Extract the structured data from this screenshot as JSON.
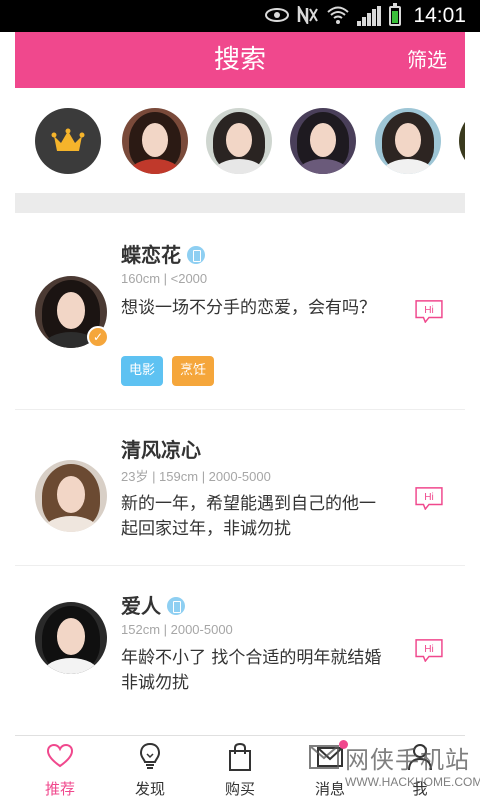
{
  "status_bar": {
    "time": "14:01",
    "icons": [
      "eye-icon",
      "nfc-icon",
      "wifi-icon",
      "signal-icon",
      "battery-charging-icon"
    ]
  },
  "header": {
    "title": "搜索",
    "filter_label": "筛选",
    "background_color": "#f0488d"
  },
  "avatar_strip": {
    "vip_icon": "crown-icon",
    "crown_color": "#f5b42b",
    "avatars": [
      "avatar-1",
      "avatar-2",
      "avatar-3",
      "avatar-4",
      "avatar-5"
    ]
  },
  "feed": [
    {
      "name": "蝶恋花",
      "phone_verified": true,
      "meta": "160cm | <2000",
      "text": "想谈一场不分手的恋爱，会有吗？",
      "avatar_verified": true,
      "tags": [
        {
          "label": "电影",
          "color": "#5ec2f2"
        },
        {
          "label": "烹饪",
          "color": "#f5a63b"
        }
      ]
    },
    {
      "name": "清风凉心",
      "phone_verified": false,
      "meta": "23岁 | 159cm | 2000-5000",
      "text": "新的一年，希望能遇到自己的他一起回家过年，非诚勿扰",
      "avatar_verified": false,
      "tags": []
    },
    {
      "name": "爱人",
      "phone_verified": true,
      "meta": "152cm | 2000-5000",
      "text": "年龄不小了 找个合适的明年就结婚　非诚勿扰",
      "avatar_verified": false,
      "tags": []
    }
  ],
  "hi_label": "Hi",
  "tabs": [
    {
      "label": "推荐",
      "icon": "heart-icon",
      "active": true
    },
    {
      "label": "发现",
      "icon": "lightbulb-icon",
      "active": false
    },
    {
      "label": "购买",
      "icon": "shopping-bag-icon",
      "active": false
    },
    {
      "label": "消息",
      "icon": "envelope-icon",
      "active": false,
      "has_notification": true
    },
    {
      "label": "我",
      "icon": "person-icon",
      "active": false
    }
  ],
  "watermark": {
    "text_cn": "网侠手机站",
    "text_en": "WWW.HACKHOME.COM"
  },
  "colors": {
    "accent": "#f0488d",
    "muted_text": "#a6a6a6",
    "divider": "#ebebeb"
  }
}
